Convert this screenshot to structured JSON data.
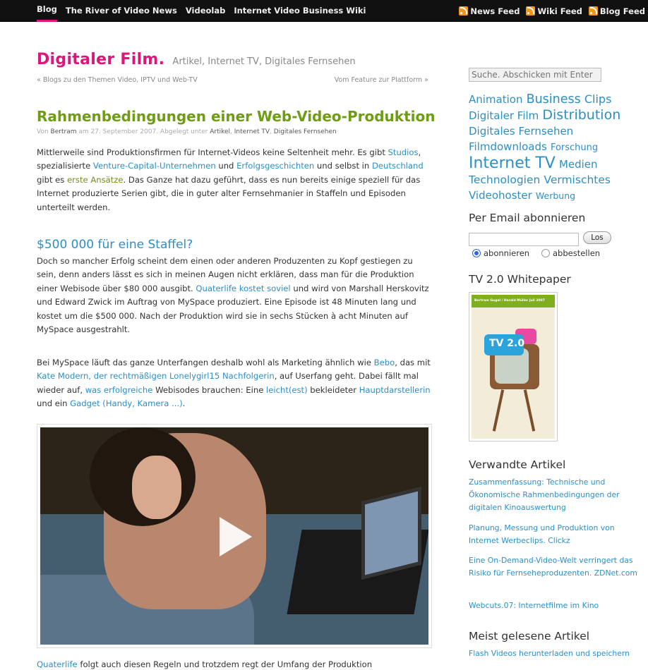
{
  "nav": {
    "items": [
      "Blog",
      "The River of Video News",
      "Videolab",
      "Internet Video Business Wiki"
    ],
    "active": "Blog",
    "feeds": [
      "News Feed",
      "Wiki Feed",
      "Blog Feed"
    ]
  },
  "site": {
    "title": "Digitaler Film.",
    "categories": "Artikel, Internet TV, Digitales Fernsehen",
    "prev_link": "« Blogs zu den Themen Video, IPTV und Web-TV",
    "next_link": "Vom Feature zur Plattform »"
  },
  "post": {
    "title": "Rahmenbedingungen einer Web-Video-Produktion",
    "meta": {
      "by": "Von",
      "author": "Bertram",
      "date_text": "am 27. September 2007. Abgelegt unter",
      "cat1": "Artikel",
      "cat2": "Internet TV",
      "cat3": "Digitales Fernsehen"
    },
    "p1": {
      "t1": "Mittlerweile sind Produktionsfirmen für Internet-Videos keine Seltenheit mehr. Es gibt ",
      "l1": "Studios",
      "t2": ", spezialisierte ",
      "l2": "Venture-Capital-Unternehmen",
      "t3": " und ",
      "l3": "Erfolgsgeschichten",
      "t4": " und selbst in ",
      "l4": "Deutschland",
      "t5": " gibt es ",
      "l5": "erste Ansätze",
      "t6": ". Das Ganze hat dazu geführt, dass es nun bereits einige speziell für das Internet produzierte Serien gibt, die in guter alter Fernsehmanier in Staffeln und Episoden unterteilt werden."
    },
    "h2": "$500 000 für eine Staffel?",
    "p2": {
      "t1": "Doch so mancher Erfolg scheint dem einen oder anderen Produzenten zu Kopf gestiegen zu sein, denn anders lässt es sich in meinen Augen nicht erklären, dass man für die Produktion einer Webisode über $80 000 ausgibt. ",
      "l1": "Quaterlife kostet soviel",
      "t2": " und wird von Marshall Herskovitz und Edward Zwick im Auftrag von MySpace produziert. Eine Episode ist 48 Minuten lang und kostet um die $500 000. Nach der Produktion wird sie in sechs Stücken à acht Minuten auf MySpace ausgestrahlt."
    },
    "p3": {
      "t1": "Bei MySpace läuft das ganze Unterfangen deshalb wohl als Marketing ähnlich wie ",
      "l1": "Bebo",
      "t2": ", das mit ",
      "l2": "Kate Modern, der rechtmäßigen Lonelygirl15 Nachfolgerin",
      "t3": ", auf Userfang geht. Dabei fällt mal wieder auf, ",
      "l3": "was erfolgreiche",
      "t4": " Webisodes brauchen: Eine ",
      "l4": "leicht(est)",
      "t5": " bekleideter ",
      "l5": "Hauptdarstellerin",
      "t6": " und ein ",
      "l6": "Gadget (Handy, Kamera ...)",
      "t7": "."
    },
    "p4": {
      "l1": "Quaterlife",
      "t1": " folgt auch diesen Regeln und trotzdem regt der Umfang der Produktion"
    }
  },
  "sidebar": {
    "search_placeholder": "Suche. Abschicken mit Enter",
    "tags": [
      {
        "label": "Animation",
        "size": 15
      },
      {
        "label": "Business",
        "size": 17.5
      },
      {
        "label": "Clips",
        "size": 16
      },
      {
        "label": "Digitaler Film",
        "size": 15
      },
      {
        "label": "Distribution",
        "size": 19
      },
      {
        "label": "Digitales Fernsehen",
        "size": 15
      },
      {
        "label": "Filmdownloads",
        "size": 15
      },
      {
        "label": "Forschung",
        "size": 13
      },
      {
        "label": "Internet TV",
        "size": 22
      },
      {
        "label": "Medien",
        "size": 15
      },
      {
        "label": "Technologien",
        "size": 15.5
      },
      {
        "label": "Vermischtes",
        "size": 15.5
      },
      {
        "label": "Videohoster",
        "size": 15
      },
      {
        "label": "Werbung",
        "size": 12.5
      }
    ],
    "email_heading": "Per Email abonnieren",
    "email_button": "Los",
    "radio_subscribe": "abonnieren",
    "radio_unsubscribe": "abbestellen",
    "whitepaper_heading": "TV 2.0 Whitepaper",
    "whitepaper_band": "Bertram Gugel / Harald Müller Juli 2007",
    "whitepaper_tv": "TV 2.0",
    "related_heading": "Verwandte Artikel",
    "related": [
      "Zusammenfassung: Technische und Ökonomische Rahmenbedingungen der digitalen Kinoauswertung",
      "Planung, Messung und Produktion von Internet Werbeclips. Clickz",
      "Eine On-Demand-Video-Welt verringert das Risiko für Fernseheproduzenten. ZDNet.com",
      "Webcuts.07: Internetfilme im Kino"
    ],
    "popular_heading": "Meist gelesene Artikel",
    "popular": [
      "Flash Videos herunterladen und speichern"
    ]
  }
}
